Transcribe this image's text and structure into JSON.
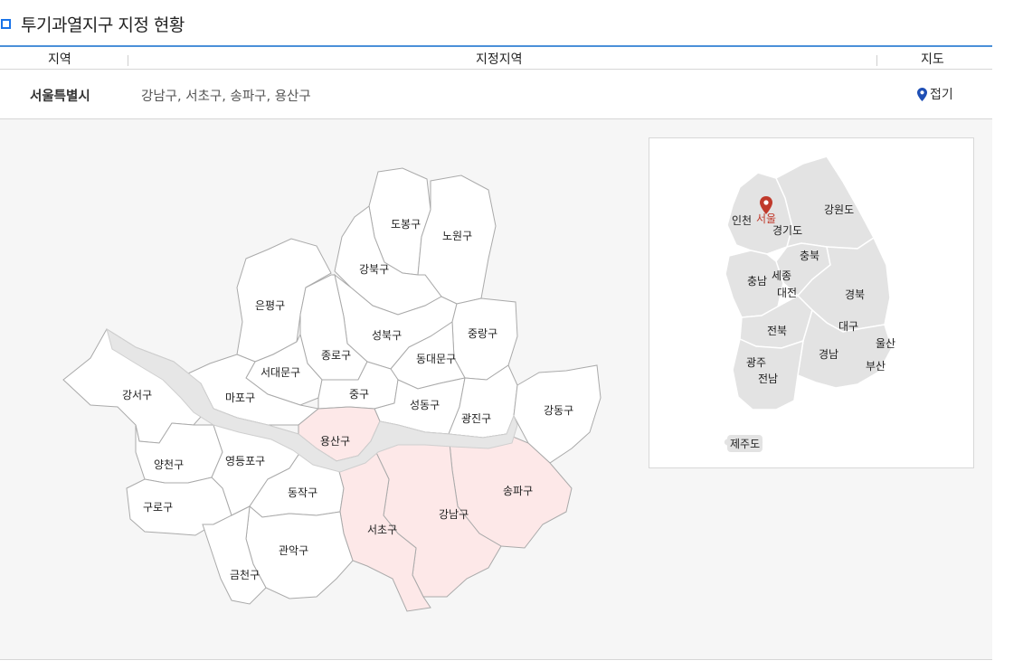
{
  "header": {
    "title": "투기과열지구 지정 현황"
  },
  "table": {
    "columns": [
      "지역",
      "지정지역",
      "지도"
    ],
    "row": {
      "region": "서울특별시",
      "areas": "강남구, 서초구, 송파구, 용산구",
      "toggle_label": "접기"
    }
  },
  "seoul_map": {
    "districts": [
      {
        "name": "도봉구",
        "highlighted": false
      },
      {
        "name": "노원구",
        "highlighted": false
      },
      {
        "name": "강북구",
        "highlighted": false
      },
      {
        "name": "은평구",
        "highlighted": false
      },
      {
        "name": "성북구",
        "highlighted": false
      },
      {
        "name": "중랑구",
        "highlighted": false
      },
      {
        "name": "종로구",
        "highlighted": false
      },
      {
        "name": "서대문구",
        "highlighted": false
      },
      {
        "name": "동대문구",
        "highlighted": false
      },
      {
        "name": "강서구",
        "highlighted": false
      },
      {
        "name": "마포구",
        "highlighted": false
      },
      {
        "name": "중구",
        "highlighted": false
      },
      {
        "name": "성동구",
        "highlighted": false
      },
      {
        "name": "광진구",
        "highlighted": false
      },
      {
        "name": "강동구",
        "highlighted": false
      },
      {
        "name": "용산구",
        "highlighted": true
      },
      {
        "name": "양천구",
        "highlighted": false
      },
      {
        "name": "영등포구",
        "highlighted": false
      },
      {
        "name": "동작구",
        "highlighted": false
      },
      {
        "name": "송파구",
        "highlighted": true
      },
      {
        "name": "구로구",
        "highlighted": false
      },
      {
        "name": "강남구",
        "highlighted": true
      },
      {
        "name": "서초구",
        "highlighted": true
      },
      {
        "name": "관악구",
        "highlighted": false
      },
      {
        "name": "금천구",
        "highlighted": false
      }
    ],
    "highlight_color": "#fde8e8"
  },
  "korea_map": {
    "selected": "서울",
    "marker_color": "#c0392b",
    "labels": [
      "인천",
      "서울",
      "경기도",
      "강원도",
      "충북",
      "충남",
      "세종",
      "대전",
      "경북",
      "전북",
      "대구",
      "울산",
      "경남",
      "광주",
      "부산",
      "전남",
      "제주도"
    ]
  }
}
